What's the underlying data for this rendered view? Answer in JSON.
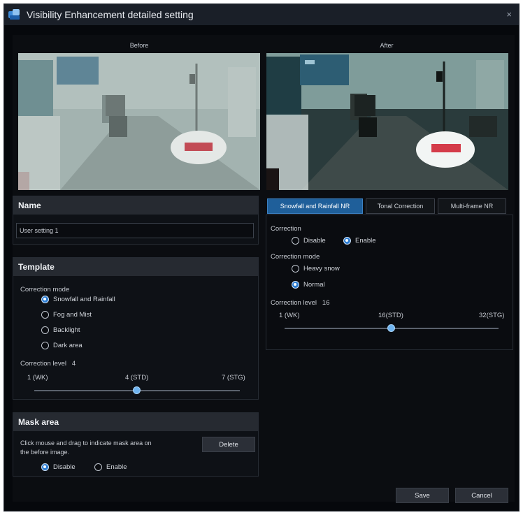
{
  "window": {
    "title": "Visibility Enhancement detailed setting",
    "close_label": "×"
  },
  "preview": {
    "before_label": "Before",
    "after_label": "After"
  },
  "name_section": {
    "header": "Name",
    "value": "User setting 1"
  },
  "template": {
    "header": "Template",
    "mode_label": "Correction mode",
    "modes": [
      {
        "label": "Snowfall and Rainfall",
        "selected": true
      },
      {
        "label": "Fog and Mist",
        "selected": false
      },
      {
        "label": "Backlight",
        "selected": false
      },
      {
        "label": "Dark area",
        "selected": false
      }
    ],
    "level_label": "Correction level",
    "level_value": "4",
    "level_min": "1 (WK)",
    "level_mid": "4 (STD)",
    "level_max": "7 (STG)",
    "level_fraction": 0.5
  },
  "mask": {
    "header": "Mask area",
    "hint_line1": "Click mouse and drag to indicate mask area on",
    "hint_line2": "the before image.",
    "delete_label": "Delete",
    "disable_label": "Disable",
    "enable_label": "Enable",
    "selected": "disable"
  },
  "tabs": [
    {
      "label": "Snowfall and Rainfall NR",
      "active": true
    },
    {
      "label": "Tonal Correction",
      "active": false
    },
    {
      "label": "Multi-frame NR",
      "active": false
    }
  ],
  "nr": {
    "correction_label": "Correction",
    "disable_label": "Disable",
    "enable_label": "Enable",
    "correction_selected": "enable",
    "mode_label": "Correction mode",
    "heavy_label": "Heavy snow",
    "normal_label": "Normal",
    "mode_selected": "normal",
    "level_label": "Correction level",
    "level_value": "16",
    "level_min": "1 (WK)",
    "level_mid": "16(STD)",
    "level_max": "32(STG)",
    "level_fraction": 0.5
  },
  "footer": {
    "save_label": "Save",
    "cancel_label": "Cancel"
  },
  "colors": {
    "accent": "#2d7dd2",
    "active_tab": "#1f5f9a",
    "header": "#262a31",
    "background": "#06080c"
  }
}
